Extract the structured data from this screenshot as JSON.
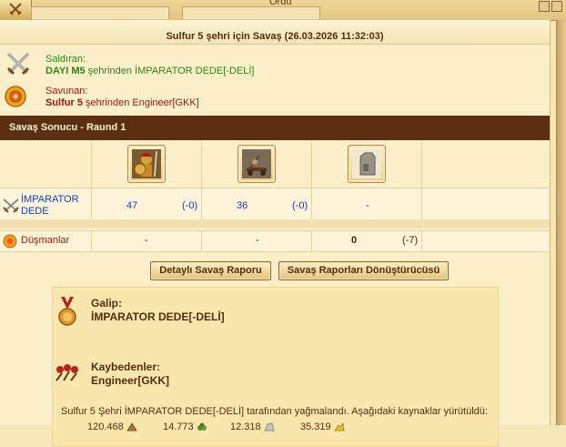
{
  "window": {
    "title": "Ordu"
  },
  "battle": {
    "title": "Sulfur 5 şehri için Savaş (26.03.2026 11:32:03)",
    "attacker_label": "Saldıran:",
    "attacker_player": "DAYI M5",
    "attacker_rest": " şehrinden İMPARATOR DEDE[-DELİ]",
    "defender_label": "Savunan:",
    "defender_city": "Sulfur 5",
    "defender_rest": " şehrinden Engineer[GKK]"
  },
  "result": {
    "header": "Savaş Sonucu - Raund 1",
    "units": [
      {
        "name": "hoplite",
        "icon": "hoplite-icon"
      },
      {
        "name": "catapult",
        "icon": "catapult-icon"
      },
      {
        "name": "wall",
        "icon": "wall-icon"
      }
    ],
    "attacker_row": {
      "name": "İMPARATOR DEDE",
      "cells": [
        {
          "count": "47",
          "loss": "(-0)"
        },
        {
          "count": "36",
          "loss": "(-0)"
        },
        {
          "count": "-",
          "loss": ""
        }
      ]
    },
    "enemy_row": {
      "name": "Düşmanlar",
      "cells": [
        {
          "count": "-",
          "loss": ""
        },
        {
          "count": "-",
          "loss": ""
        },
        {
          "count": "0",
          "loss": "(-7)"
        }
      ]
    }
  },
  "buttons": {
    "detail": "Detaylı Savaş Raporu",
    "converter": "Savaş Raporları Dönüştürücüsü"
  },
  "report": {
    "winner_label": "Galip:",
    "winner_name": "İMPARATOR DEDE[-DELİ]",
    "loser_label": "Kaybedenler:",
    "loser_name": "Engineer[GKK]",
    "plunder_text": "Sulfur 5 Şehri İMPARATOR DEDE[-DELİ] tarafından yağmalandı. Aşağıdaki kaynaklar yürütüldü:",
    "resources": [
      {
        "value": "120.468",
        "icon": "wood-icon"
      },
      {
        "value": "14.773",
        "icon": "wine-icon"
      },
      {
        "value": "12.318",
        "icon": "marble-icon"
      },
      {
        "value": "35.319",
        "icon": "sulfur-icon"
      }
    ]
  },
  "colors": {
    "header_bar": "#5b2e10",
    "attacker_green": "#2a8a12",
    "defender_red": "#a3180c",
    "link_blue": "#1a3cc7"
  }
}
